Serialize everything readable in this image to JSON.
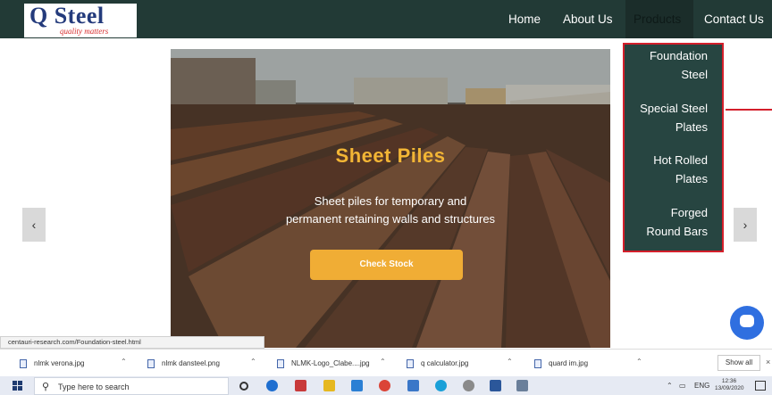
{
  "logo": {
    "name": "Q Steel",
    "tagline": "quality matters"
  },
  "nav": {
    "home": "Home",
    "about": "About Us",
    "products": "Products",
    "contact": "Contact Us"
  },
  "dropdown": {
    "items": [
      {
        "line1": "Foundation",
        "line2": "Steel"
      },
      {
        "line1": "Special Steel",
        "line2": "Plates"
      },
      {
        "line1": "Hot Rolled",
        "line2": "Plates"
      },
      {
        "line1": "Forged",
        "line2": "Round Bars"
      }
    ]
  },
  "hero": {
    "title": "Sheet Piles",
    "subtitle_line1": "Sheet piles for temporary and",
    "subtitle_line2": "permanent retaining walls and structures",
    "button": "Check Stock"
  },
  "carousel": {
    "prev": "‹",
    "next": "›"
  },
  "status_url": "centauri-research.com/Foundation-steel.html",
  "downloads": {
    "items": [
      "nlmk verona.jpg",
      "nlmk dansteel.png",
      "NLMK-Logo_Clabe....jpg",
      "q calculator.jpg",
      "quard im.jpg"
    ],
    "show_all": "Show all"
  },
  "taskbar": {
    "search_placeholder": "Type here to search",
    "language": "ENG",
    "time": "12:36",
    "date": "13/09/2020"
  },
  "colors": {
    "navbar": "#223a36",
    "accent": "#f0ad35",
    "dropdown_border": "#d41f2b"
  }
}
